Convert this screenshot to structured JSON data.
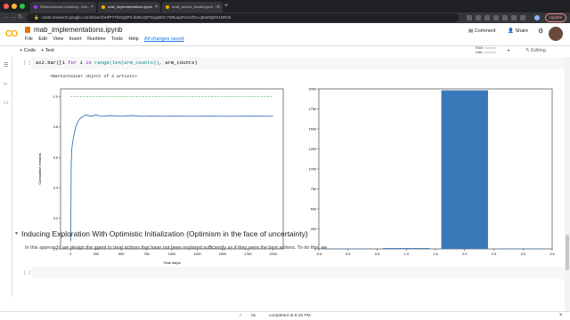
{
  "browser": {
    "tabs": [
      {
        "label": "Reinforcement Learning - Mul..."
      },
      {
        "label": "mab_implementations.ipynb"
      },
      {
        "label": "multi_armed_bandit.ipynb - C..."
      }
    ],
    "new_tab": "+",
    "url": "colab.research.google.com/drive/1hHfPYTkKQqPS-bb9cxQFSqxpEbC7W5uqa#scrollTo=qEw0QDK1DRnh",
    "update_label": "Update"
  },
  "colab": {
    "logo": "CO",
    "notebook_title": "mab_implementations.ipynb",
    "menu": [
      "File",
      "Edit",
      "View",
      "Insert",
      "Runtime",
      "Tools",
      "Help"
    ],
    "saved_status": "All changes saved",
    "comment_label": "Comment",
    "share_label": "Share"
  },
  "toolbar": {
    "code_label": "+ Code",
    "text_label": "+ Text",
    "ram_label": "RAM",
    "disk_label": "Disk",
    "editing_label": "Editing"
  },
  "cell": {
    "code_prefix": "ax2.bar([i ",
    "code_kw": "for",
    "code_mid": " i ",
    "code_kw2": "in",
    "code_fn": " range(len(arm_counts))",
    "code_suffix": ", arm_counts)",
    "bracket": "[ ]",
    "output": "<BarContainer object of 4 artists>"
  },
  "empty_cell": {
    "bracket": "[ ]"
  },
  "chart_data": [
    {
      "type": "line",
      "xlabel": "Time steps",
      "ylabel": "Cumulative rewards",
      "xlim": [
        -100,
        2100
      ],
      "ylim": [
        0,
        1.05
      ],
      "xticks": [
        "0",
        "250",
        "500",
        "750",
        "1000",
        "1250",
        "1500",
        "1750",
        "2000"
      ],
      "yticks": [
        "0.0",
        "0.2",
        "0.4",
        "0.6",
        "0.8",
        "1.0"
      ],
      "series": [
        {
          "color": "#3a77b8",
          "x": [
            0,
            5,
            10,
            20,
            30,
            50,
            75,
            100,
            150,
            200,
            250,
            300,
            400,
            500,
            600,
            700,
            800,
            900,
            1000,
            1200,
            1400,
            1600,
            1800,
            2000
          ],
          "y": [
            0.05,
            0.55,
            0.65,
            0.7,
            0.74,
            0.8,
            0.84,
            0.86,
            0.88,
            0.87,
            0.88,
            0.87,
            0.875,
            0.87,
            0.875,
            0.87,
            0.872,
            0.87,
            0.872,
            0.87,
            0.872,
            0.87,
            0.872,
            0.87
          ]
        },
        {
          "color": "#4caf50",
          "style": "dashed",
          "x": [
            0,
            2000
          ],
          "y": [
            1.0,
            1.0
          ]
        }
      ]
    },
    {
      "type": "bar",
      "xlim": [
        -0.5,
        3.5
      ],
      "ylim": [
        0,
        2000
      ],
      "xticks": [
        "-0.5",
        "0.0",
        "0.5",
        "1.0",
        "1.5",
        "2.0",
        "2.5",
        "3.0",
        "3.5"
      ],
      "yticks": [
        "0",
        "250",
        "500",
        "750",
        "1000",
        "1250",
        "1500",
        "1750",
        "2000"
      ],
      "x": [
        0,
        1,
        2,
        3
      ],
      "values": [
        3,
        10,
        1982,
        5
      ],
      "color": "#3a77b8"
    }
  ],
  "section": {
    "heading": "Inducing Exploration With Optimistic Initialization (Optimism in the face of uncertainty)",
    "paragraph": "In this approach, we design the agent to treat actions that have not been explored sufficiently as if they were the best actions. To do this, we"
  },
  "status": {
    "check": "✓",
    "elapsed": "0s",
    "completed": "completed at 9:16 PM",
    "close": "×"
  },
  "colors": {
    "accent": "#1a73e8",
    "line": "#3a77b8",
    "optimal": "#4caf50",
    "logo": "#f9ab00"
  }
}
